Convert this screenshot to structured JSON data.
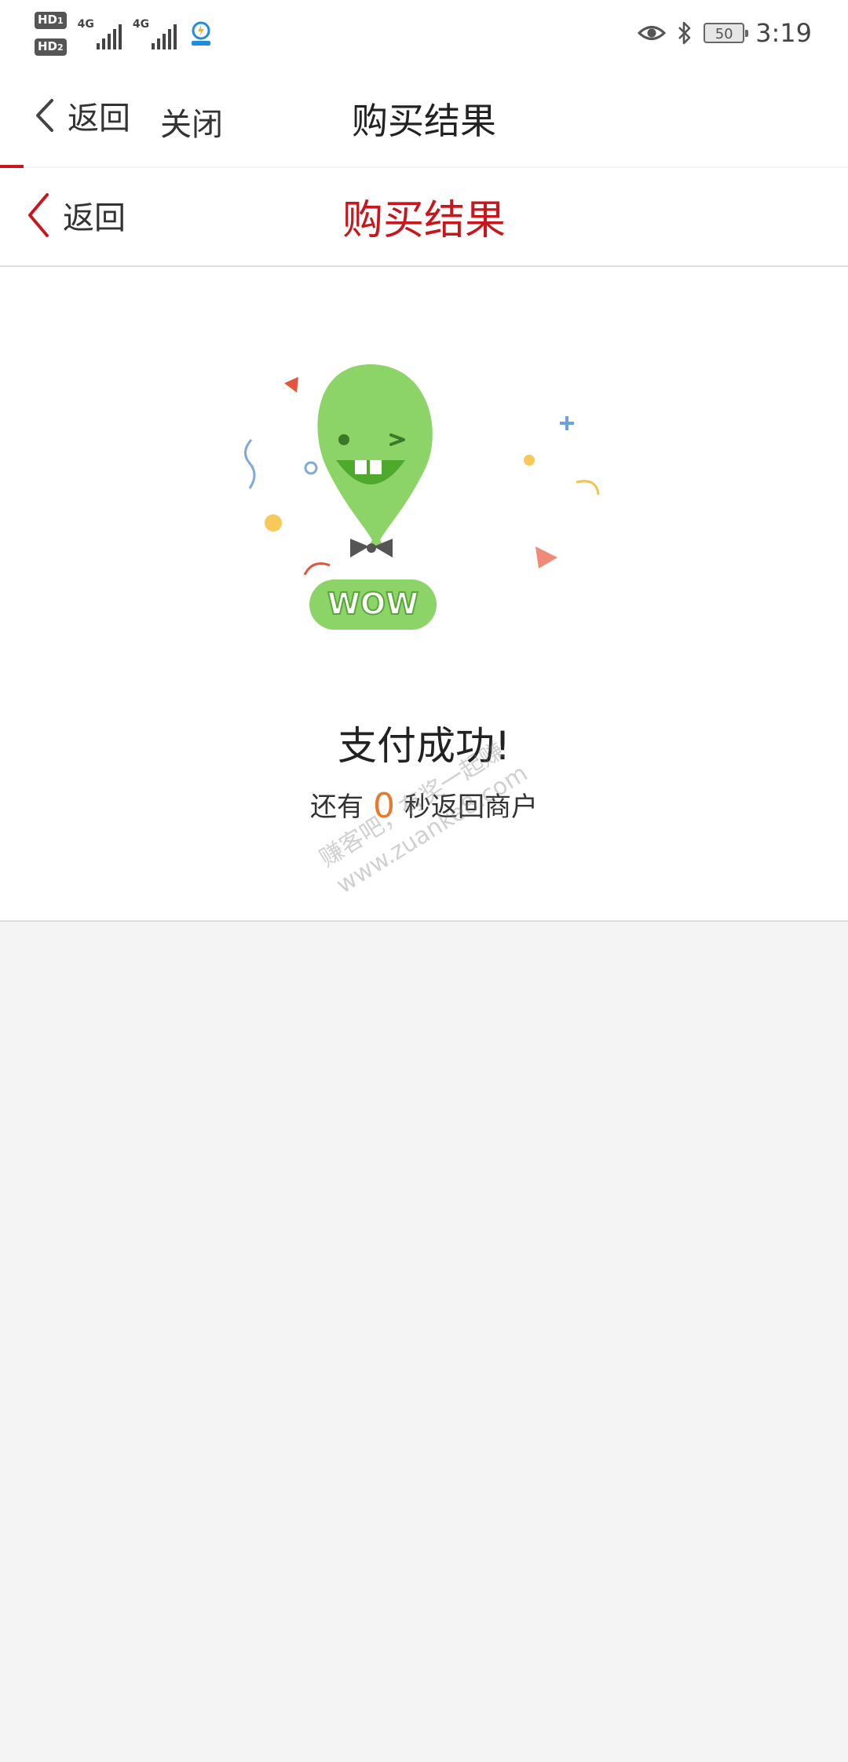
{
  "status_bar": {
    "hd1": "HD",
    "hd1_sub": "1",
    "hd2": "HD",
    "hd2_sub": "2",
    "net1": "4G",
    "net2": "4G",
    "battery": "50",
    "time": "3:19",
    "icons": [
      "eye-icon",
      "bluetooth-icon",
      "battery-icon",
      "signal-icon",
      "app-notification-icon"
    ]
  },
  "outer_nav": {
    "back_label": "返回",
    "close_label": "关闭",
    "title": "购买结果"
  },
  "inner_nav": {
    "back_label": "返回",
    "title": "购买结果"
  },
  "result": {
    "illustration_text": "WOW",
    "message": "支付成功!",
    "countdown_prefix": "还有",
    "countdown_value": "0",
    "countdown_suffix": "秒返回商户"
  },
  "watermark": {
    "line1": "赚客吧，有奖一起赚",
    "line2": "www.zuanke8.com"
  },
  "colors": {
    "accent_red": "#c8161d",
    "countdown_orange": "#e8782e",
    "balloon_green": "#8cd467",
    "page_bg": "#f4f4f4"
  }
}
